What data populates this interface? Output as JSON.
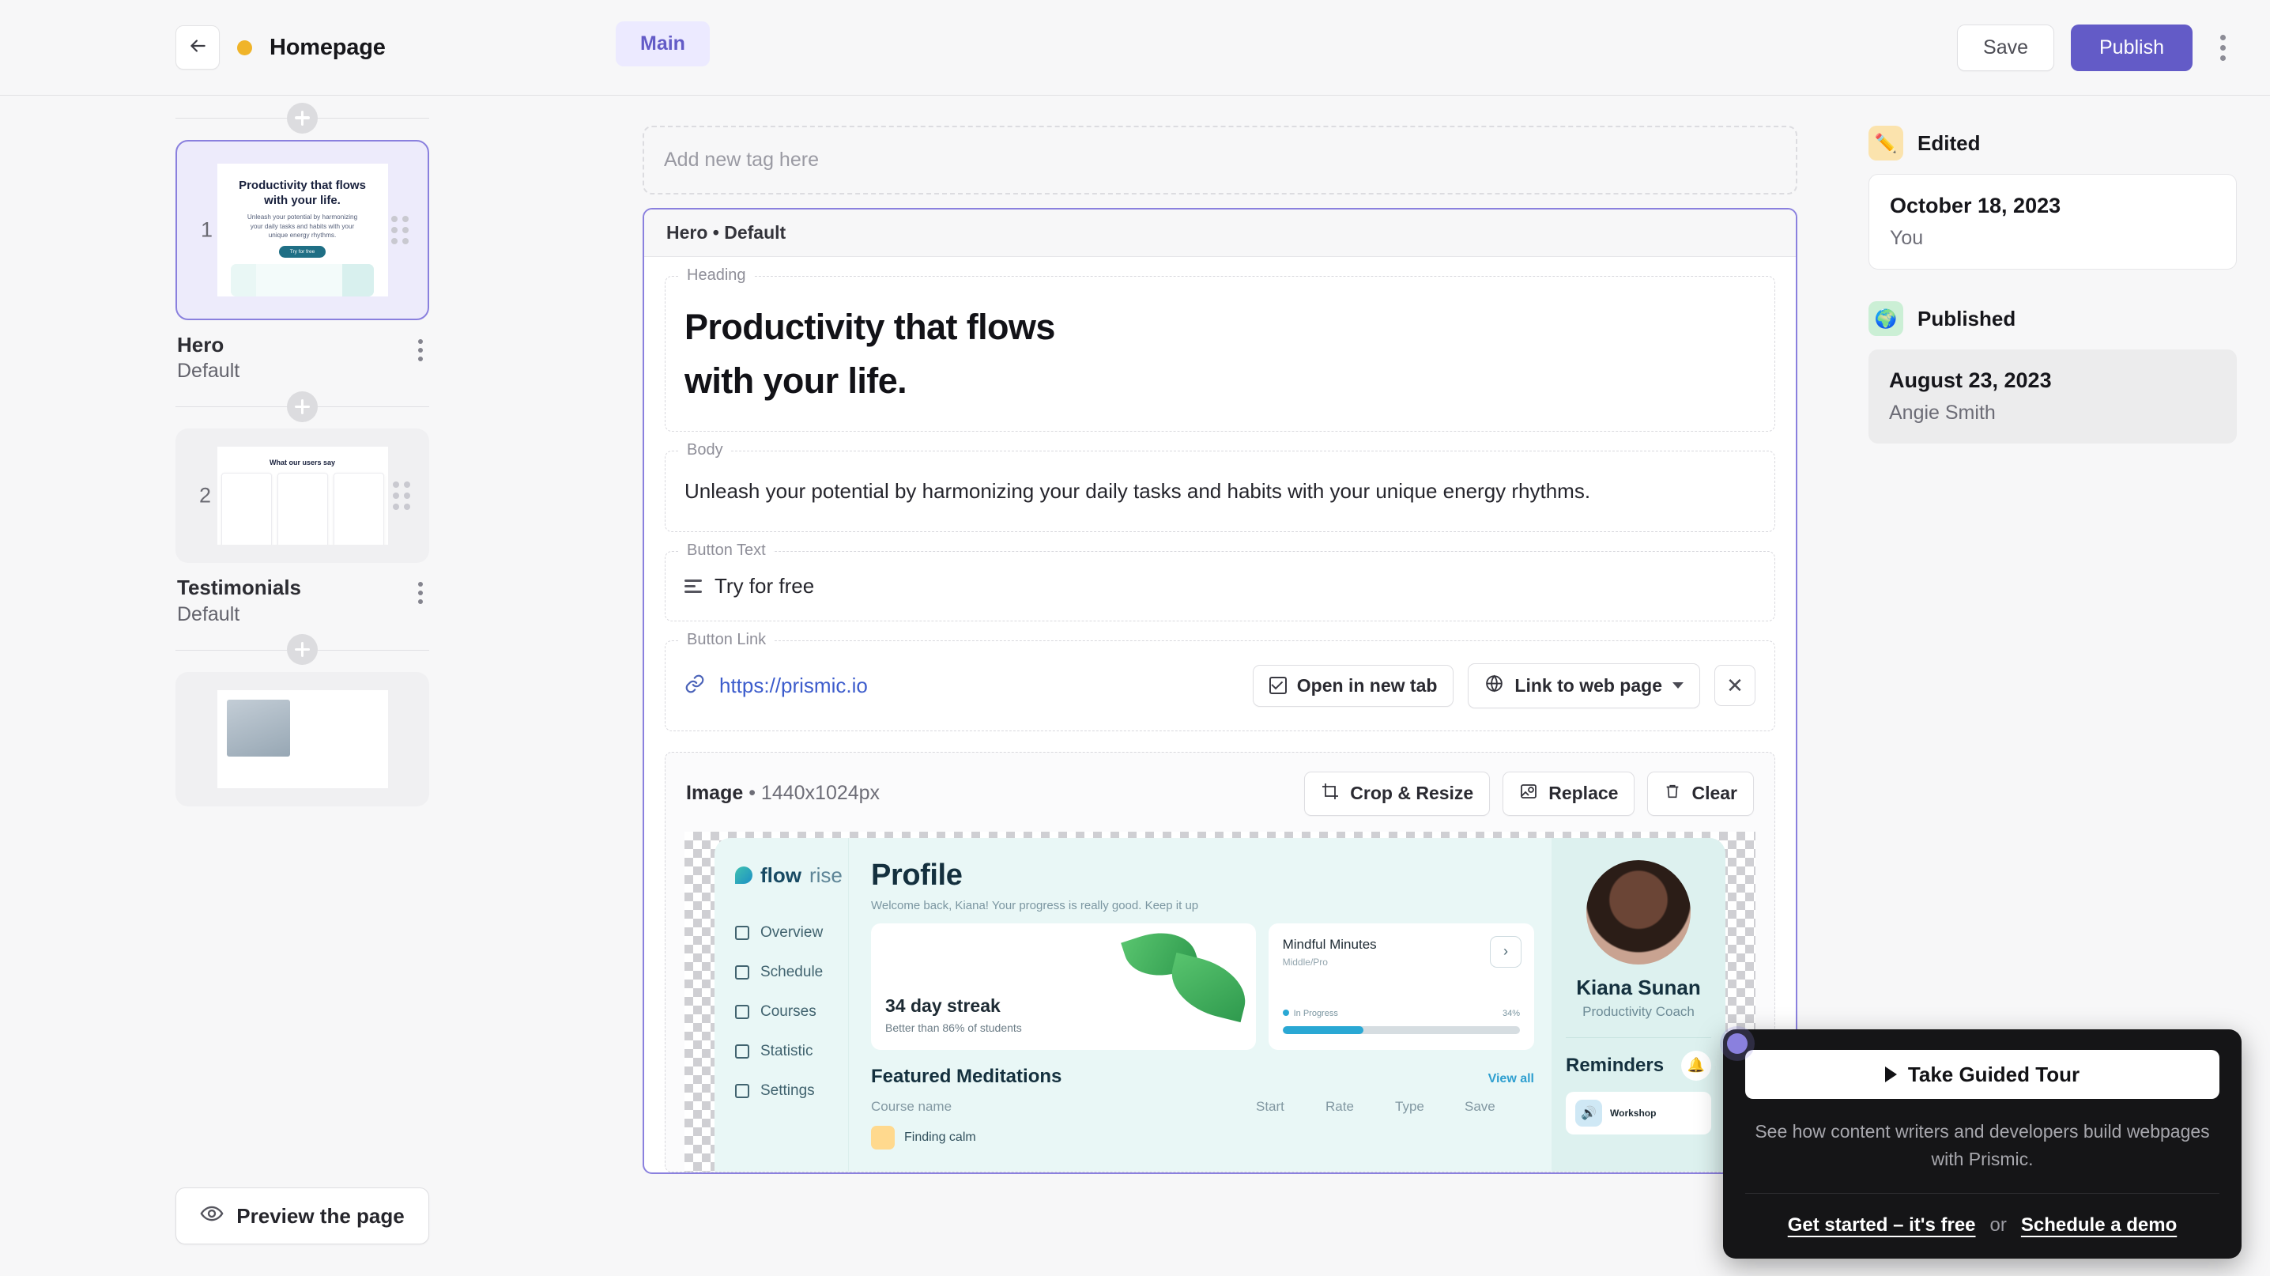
{
  "topbar": {
    "back_icon": "arrow-left-icon",
    "status_dot_color": "#f0b429",
    "page_title": "Homepage",
    "tab_main": "Main",
    "save_label": "Save",
    "publish_label": "Publish",
    "more_icon": "kebab-menu-icon",
    "accent_color": "#635bc7"
  },
  "sidebar": {
    "slices": [
      {
        "number": "1",
        "name": "Hero",
        "variation": "Default",
        "selected": true,
        "thumb": {
          "heading_line1": "Productivity that flows",
          "heading_line2": "with your life.",
          "body": "Unleash your potential by harmonizing your daily tasks and habits with your unique energy rhythms.",
          "button": "Try for free"
        }
      },
      {
        "number": "2",
        "name": "Testimonials",
        "variation": "Default",
        "selected": false,
        "thumb": {
          "heading": "What our users say"
        }
      },
      {
        "number": "3",
        "name": "",
        "variation": "",
        "selected": false,
        "thumb": {
          "heading": ""
        }
      }
    ],
    "add_slice_label": "+",
    "preview_button": "Preview the page",
    "preview_icon": "eye-icon"
  },
  "center": {
    "tag_placeholder": "Add new tag here",
    "slice_header": "Hero • Default",
    "fields": {
      "heading_label": "Heading",
      "heading_line1": "Productivity that flows",
      "heading_line2": "with your life.",
      "body_label": "Body",
      "body_value": "Unleash your potential by harmonizing your daily tasks and habits with your unique energy rhythms.",
      "button_text_label": "Button Text",
      "button_text_value": "Try for free",
      "button_link_label": "Button Link",
      "button_link_value": "https://prismic.io",
      "open_new_tab": "Open in new tab",
      "link_type": "Link to web page",
      "clear_link_icon": "close-icon"
    },
    "image": {
      "label": "Image",
      "dimensions": "1440x1024px",
      "crop_resize": "Crop & Resize",
      "replace": "Replace",
      "clear": "Clear",
      "preview": {
        "logo_bold": "flow",
        "logo_light": "rise",
        "nav": [
          "Overview",
          "Schedule",
          "Courses",
          "Statistic",
          "Settings"
        ],
        "title": "Profile",
        "subtitle": "Welcome back, Kiana! Your progress is really good. Keep it up",
        "streak_value": "34 day streak",
        "streak_sub": "Better than 86% of students",
        "mindful_title": "Mindful Minutes",
        "mindful_sub": "Middle/Pro",
        "progress_label": "In Progress",
        "progress_value": "34%",
        "featured_title": "Featured Meditations",
        "view_all": "View all",
        "table_columns": [
          "Course name",
          "Start",
          "Rate",
          "Type",
          "Save"
        ],
        "row_name": "Finding calm",
        "person_name": "Kiana Sunan",
        "person_role": "Productivity Coach",
        "reminders_title": "Reminders",
        "reminder_item": "Workshop"
      }
    }
  },
  "rightbar": {
    "edited": {
      "status": "Edited",
      "icon": "pencil-icon",
      "date": "October 18, 2023",
      "author": "You"
    },
    "published": {
      "status": "Published",
      "icon": "globe-icon",
      "date": "August 23, 2023",
      "author": "Angie Smith"
    }
  },
  "tour": {
    "button": "Take Guided Tour",
    "play_icon": "play-icon",
    "description": "See how content writers and developers build webpages with Prismic.",
    "cta_primary": "Get started – it's free",
    "cta_separator": "or",
    "cta_secondary": "Schedule a demo"
  }
}
